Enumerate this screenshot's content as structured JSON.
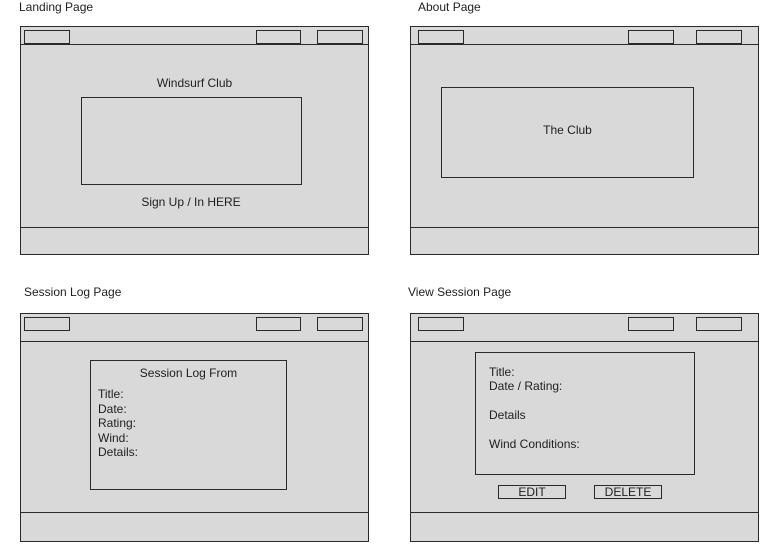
{
  "pages": {
    "landing": {
      "caption": "Landing Page",
      "heading": "Windsurf Club",
      "cta": "Sign Up / In HERE"
    },
    "about": {
      "caption": "About Page",
      "box_text": "The Club"
    },
    "session_log": {
      "caption": "Session Log Page",
      "form_title": "Session Log From",
      "fields": [
        "Title:",
        "Date:",
        "Rating:",
        "Wind:",
        "Details:"
      ]
    },
    "view_session": {
      "caption": "View Session Page",
      "lines": [
        "Title:",
        "Date / Rating:",
        "Details",
        "Wind Conditions:"
      ],
      "edit_label": "EDIT",
      "delete_label": "DELETE"
    }
  }
}
